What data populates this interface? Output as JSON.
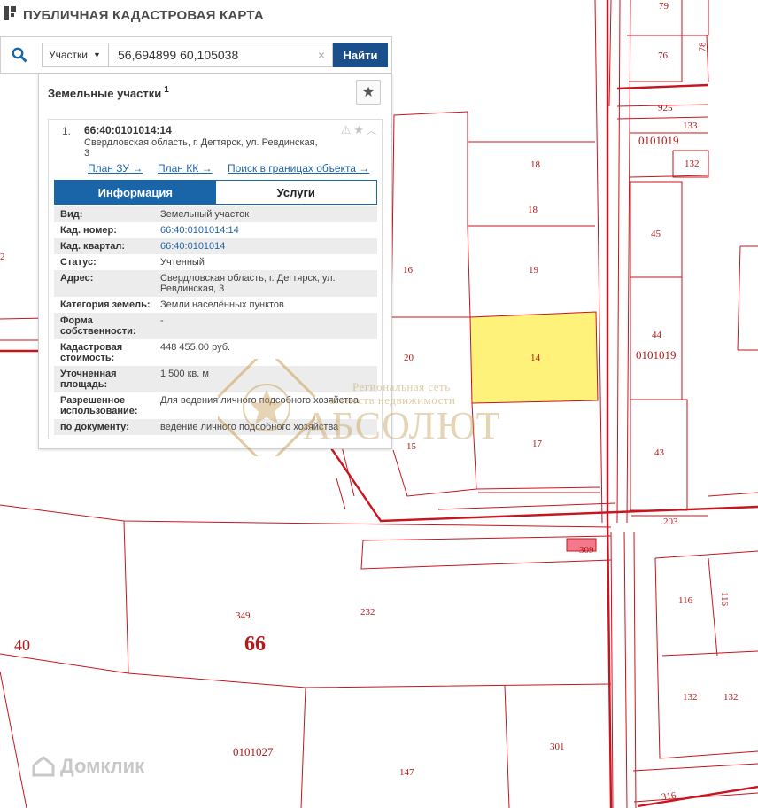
{
  "header": {
    "title": "ПУБЛИЧНАЯ КАДАСТРОВАЯ КАРТА"
  },
  "search": {
    "type_label": "Участки",
    "query": "56,694899 60,105038",
    "clear_glyph": "×",
    "submit_label": "Найти"
  },
  "panel": {
    "title": "Земельные участки",
    "count": "1",
    "card": {
      "index": "1.",
      "kad_number": "66:40:0101014:14",
      "address": "Свердловская область, г. Дегтярск, ул. Ревдинская, 3",
      "links": [
        "План ЗУ →",
        "План КК →",
        "Поиск в границах объекта →"
      ],
      "tabs": [
        "Информация",
        "Услуги"
      ],
      "rows": [
        {
          "k": "Вид:",
          "v": "Земельный участок"
        },
        {
          "k": "Кад. номер:",
          "v": "66:40:0101014:14"
        },
        {
          "k": "Кад. квартал:",
          "v": "66:40:0101014"
        },
        {
          "k": "Статус:",
          "v": "Учтенный"
        },
        {
          "k": "Адрес:",
          "v": "Свердловская область, г. Дегтярск, ул. Ревдинская, 3"
        },
        {
          "k": "Категория земель:",
          "v": "Земли населённых пунктов"
        },
        {
          "k": "Форма собственности:",
          "v": "-"
        },
        {
          "k": "Кадастровая стоимость:",
          "v": "448 455,00 руб."
        },
        {
          "k": "Уточненная площадь:",
          "v": "1 500 кв. м"
        },
        {
          "k": "Разрешенное использование:",
          "v": "Для ведения личного подсобного хозяйства"
        },
        {
          "k": "по документу:",
          "v": "ведение личного подсобного хозяйства"
        }
      ]
    }
  },
  "map_labels": {
    "l79": "79",
    "l76": "76",
    "l78": "78",
    "l925": "925",
    "l133": "133",
    "q0101019a": "0101019",
    "l132a": "132",
    "l18a": "18",
    "l18b": "18",
    "l45": "45",
    "l16": "16",
    "l19": "19",
    "l2": "2",
    "l14": "14",
    "l20": "20",
    "l44": "44",
    "q0101019b": "0101019",
    "l15": "15",
    "l17": "17",
    "l43": "43",
    "l203": "203",
    "l309": "309",
    "l116a": "116",
    "l116b": "116",
    "l349": "349",
    "l232": "232",
    "l40": "40",
    "l66": "66",
    "l132b": "132",
    "l132c": "132",
    "q0101027": "0101027",
    "l301": "301",
    "l147": "147",
    "l316": "316"
  },
  "watermark": {
    "line1": "Региональная сеть",
    "line2": "агентств недвижимости",
    "brand": "АБСОЛЮТ"
  },
  "branding": {
    "domclick": "Домклик"
  },
  "colors": {
    "boundary": "#c8141e",
    "selected_fill": "#fff27a",
    "accent": "#1a4f8b"
  }
}
